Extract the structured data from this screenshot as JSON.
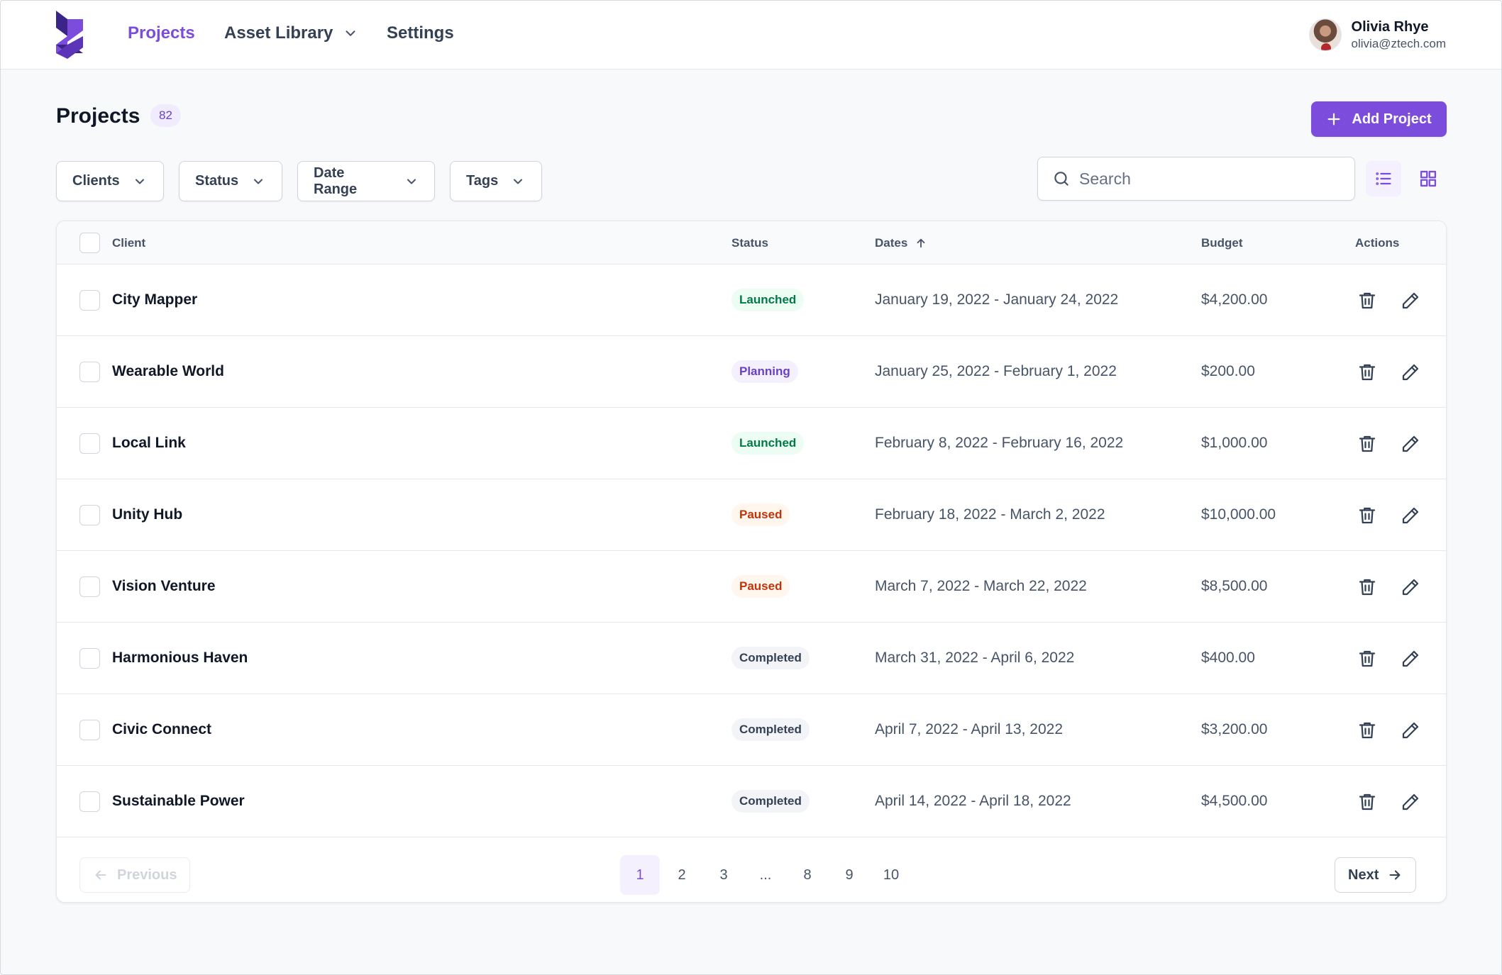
{
  "nav": {
    "links": [
      {
        "label": "Projects",
        "active": true
      },
      {
        "label": "Asset Library",
        "active": false
      },
      {
        "label": "Settings",
        "active": false
      }
    ],
    "user": {
      "name": "Olivia Rhye",
      "email": "olivia@ztech.com"
    }
  },
  "header": {
    "title": "Projects",
    "count": "82",
    "add_button": "Add Project"
  },
  "filters": [
    "Clients",
    "Status",
    "Date Range",
    "Tags"
  ],
  "search": {
    "placeholder": "Search",
    "value": ""
  },
  "view": {
    "active": "list"
  },
  "table": {
    "columns": {
      "client": "Client",
      "status": "Status",
      "dates": "Dates",
      "budget": "Budget",
      "actions": "Actions"
    },
    "sort": {
      "column": "Dates",
      "direction": "ascending"
    },
    "rows": [
      {
        "client": "City Mapper",
        "status": "Launched",
        "dates": "January 19, 2022 - January 24, 2022",
        "budget": "$4,200.00"
      },
      {
        "client": "Wearable World",
        "status": "Planning",
        "dates": "January 25, 2022 - February 1, 2022",
        "budget": "$200.00"
      },
      {
        "client": "Local Link",
        "status": "Launched",
        "dates": "February 8, 2022 - February 16, 2022",
        "budget": "$1,000.00"
      },
      {
        "client": "Unity Hub",
        "status": "Paused",
        "dates": "February 18, 2022 - March 2, 2022",
        "budget": "$10,000.00"
      },
      {
        "client": "Vision Venture",
        "status": "Paused",
        "dates": "March 7, 2022 - March 22, 2022",
        "budget": "$8,500.00"
      },
      {
        "client": "Harmonious Haven",
        "status": "Completed",
        "dates": "March 31, 2022 - April 6, 2022",
        "budget": "$400.00"
      },
      {
        "client": "Civic Connect",
        "status": "Completed",
        "dates": "April 7, 2022 - April 13, 2022",
        "budget": "$3,200.00"
      },
      {
        "client": "Sustainable Power",
        "status": "Completed",
        "dates": "April 14, 2022 - April 18, 2022",
        "budget": "$4,500.00"
      }
    ]
  },
  "status_colors": {
    "Launched": {
      "bg": "#ecfdf3",
      "fg": "#027a48"
    },
    "Planning": {
      "bg": "#f4f0fe",
      "fg": "#6941c6"
    },
    "Paused": {
      "bg": "#fff6ed",
      "fg": "#c4320a"
    },
    "Completed": {
      "bg": "#f2f4f7",
      "fg": "#344054"
    }
  },
  "pagination": {
    "previous": "Previous",
    "next": "Next",
    "pages": [
      "1",
      "2",
      "3",
      "...",
      "8",
      "9",
      "10"
    ],
    "current": "1"
  },
  "colors": {
    "accent": "#7c4ddc",
    "logo_dark": "#3b2487"
  },
  "icons": [
    "logo-icon",
    "chevron-down-icon",
    "plus-icon",
    "search-icon",
    "list-view-icon",
    "grid-view-icon",
    "arrow-up-icon",
    "trash-icon",
    "edit-icon",
    "arrow-left-icon",
    "arrow-right-icon"
  ]
}
